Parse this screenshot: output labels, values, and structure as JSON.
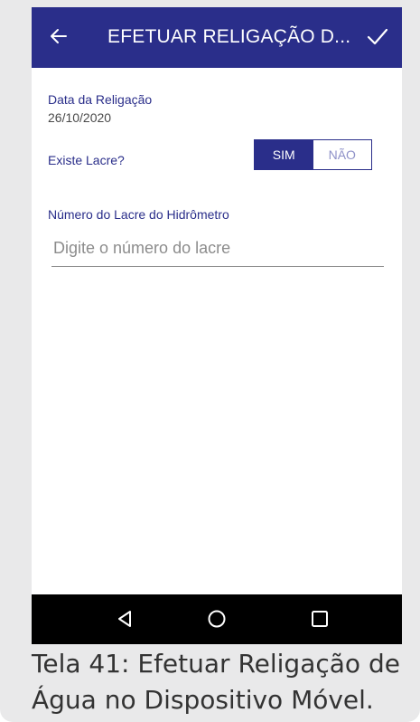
{
  "appbar": {
    "title": "EFETUAR RELIGAÇÃO D...",
    "back_icon": "arrow-left-icon",
    "confirm_icon": "check-icon"
  },
  "form": {
    "date_label": "Data da Religação",
    "date_value": "26/10/2020",
    "seal_question": "Existe Lacre?",
    "seal_options": [
      "SIM",
      "NÃO"
    ],
    "seal_selected": "SIM",
    "meter_seal_label": "Número do Lacre do Hidrômetro",
    "meter_seal_value": "",
    "meter_seal_placeholder": "Digite o número do lacre"
  },
  "navbar": {
    "back": "triangle-back-icon",
    "home": "circle-home-icon",
    "recents": "square-recents-icon"
  },
  "caption": "Tela 41: Efetuar Religação de Água no Dispositivo Móvel.",
  "colors": {
    "primary": "#2a2e8a",
    "primary_light": "#8e91c8",
    "navbar": "#000000",
    "frame": "#e9e9ea"
  }
}
